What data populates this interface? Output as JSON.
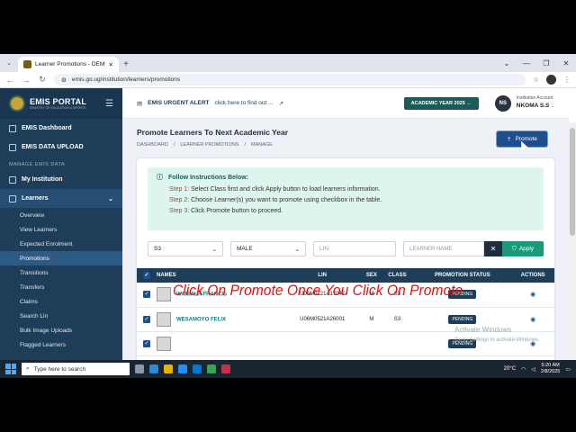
{
  "browser": {
    "tab_title": "Learner Promotions - DEMIS",
    "url": "emis.go.ug/institution/learners/promotions",
    "new_tab": "+",
    "window_controls": [
      "⌄",
      "—",
      "❐",
      "✕"
    ]
  },
  "brand": {
    "title": "EMIS PORTAL",
    "subtitle": "MINISTRY OF EDUCATION & SPORTS"
  },
  "sidebar": {
    "items": [
      {
        "label": "EMIS Dashboard"
      },
      {
        "label": "EMIS DATA UPLOAD"
      }
    ],
    "section_label": "MANAGE EMIS DATA",
    "my_institution": "My Institution",
    "learners": "Learners",
    "sub_items": [
      {
        "label": "Overview"
      },
      {
        "label": "View Learners"
      },
      {
        "label": "Expected Enrolment"
      },
      {
        "label": "Promotions"
      },
      {
        "label": "Transitions"
      },
      {
        "label": "Transfers"
      },
      {
        "label": "Claims"
      },
      {
        "label": "Search Lin"
      },
      {
        "label": "Bulk Image Uploads"
      },
      {
        "label": "Flagged Learners"
      }
    ]
  },
  "topbar": {
    "alert_title": "EMIS URGENT ALERT",
    "alert_link": "click here to find out ...",
    "year": "ACADEMIC YEAR 2025",
    "avatar": "NS",
    "account_label": "Institution Account",
    "account_name": "NKOMA S.S"
  },
  "page": {
    "title": "Promote Learners To Next Academic Year",
    "crumbs": [
      "DASHBOARD",
      "/",
      "LEARNER PROMOTIONS",
      "/",
      "MANAGE"
    ],
    "promote_label": "Promote"
  },
  "instructions": {
    "title": "Follow Instructions Below:",
    "steps": [
      {
        "num": "Step 1:",
        "text": "Select Class first and click Apply button to load learners information."
      },
      {
        "num": "Step 2:",
        "text": "Choose Learner(s) you want to promote using checkbox in the table."
      },
      {
        "num": "Step 3:",
        "text": "Click Promote button to proceed."
      }
    ]
  },
  "filters": {
    "class": "S3",
    "sex": "MALE",
    "lin_placeholder": "LIN",
    "name_placeholder": "LEARNER NAME",
    "apply_label": "Apply"
  },
  "table": {
    "headers": [
      "NAMES",
      "LIN",
      "SEX",
      "CLASS",
      "PROMOTION STATUS",
      "ACTIONS"
    ],
    "rows": [
      {
        "name": "WANIALA FRANCIS",
        "lin": "U06M0121A17047",
        "sex": "M",
        "class": "S3",
        "status": "PENDING"
      },
      {
        "name": "WESAMOYO FELIX",
        "lin": "U06M0521A26001",
        "sex": "M",
        "class": "S3",
        "status": "PENDING"
      },
      {
        "name": "",
        "lin": "",
        "sex": "",
        "class": "",
        "status": "PENDING"
      }
    ]
  },
  "overlay_text": "Click On Promote Once You Click On Promote",
  "windows_activation": {
    "title": "Activate Windows",
    "subtitle": "Go to Settings to activate Windows."
  },
  "taskbar": {
    "search_placeholder": "Type here to search",
    "temperature": "20°C",
    "time": "5:20 AM",
    "date": "2/8/2025"
  }
}
